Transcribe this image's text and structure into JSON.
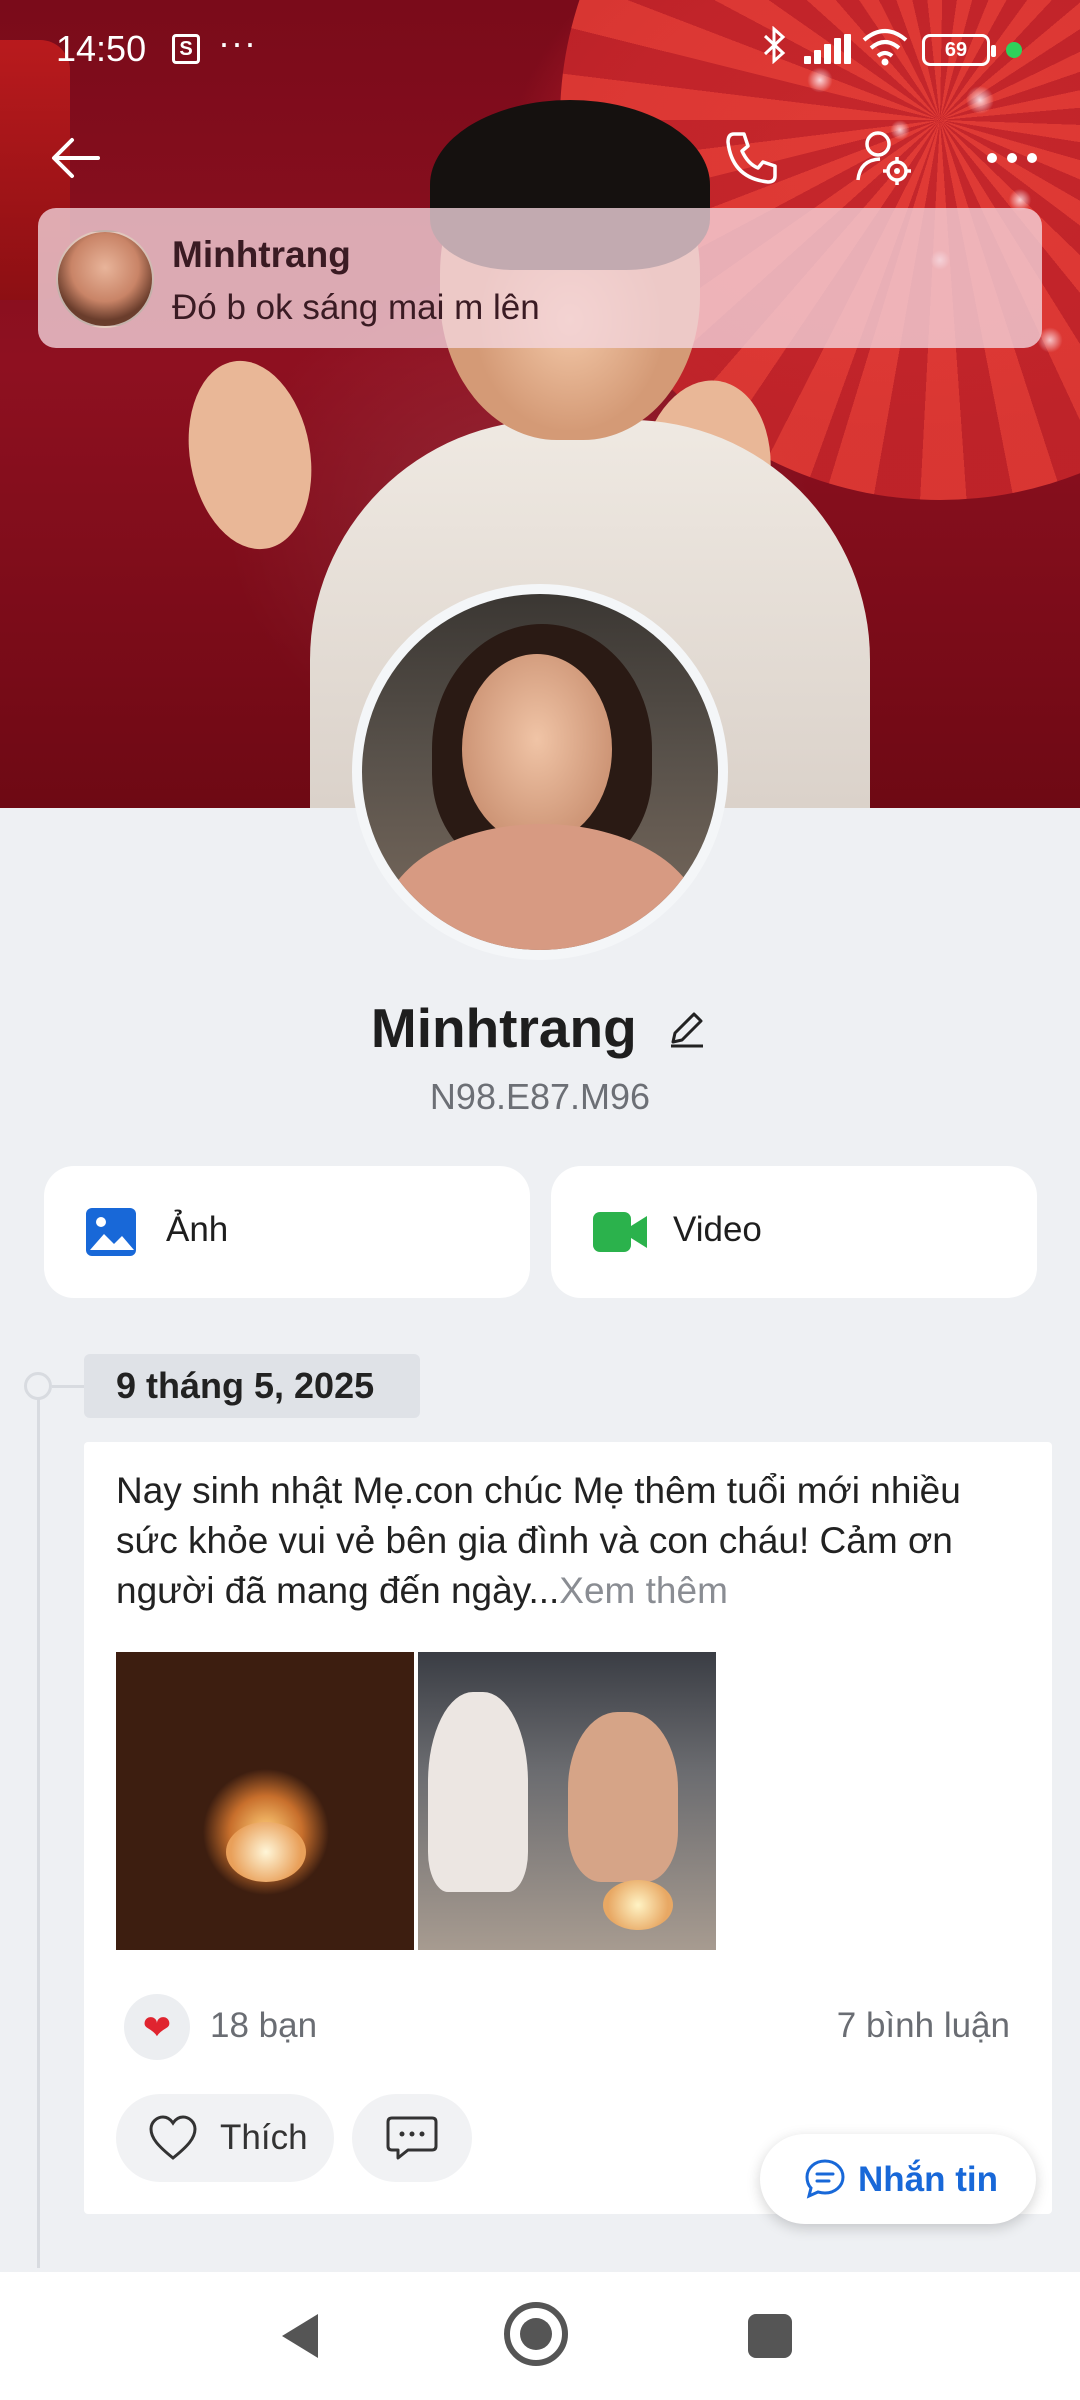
{
  "status_bar": {
    "time": "14:50",
    "shop_icon_letter": "S",
    "more_indicator": "···",
    "battery": "69",
    "icons": [
      "shopee-bag-icon",
      "bluetooth-icon",
      "signal-icon",
      "wifi-icon",
      "battery-icon",
      "active-dot-icon"
    ]
  },
  "top_bar": {
    "icons": [
      "back-arrow-icon",
      "phone-call-icon",
      "user-settings-icon",
      "more-dots-icon"
    ]
  },
  "notification": {
    "sender": "Minhtrang",
    "message": "Đó b ok sáng mai m lên"
  },
  "profile": {
    "name": "Minhtrang",
    "handle": "N98.E87.M96"
  },
  "media_cards": {
    "photo_label": "Ảnh",
    "video_label": "Video"
  },
  "timeline": {
    "date": "9 tháng 5, 2025"
  },
  "post": {
    "text": "Nay sinh nhật Mẹ.con chúc Mẹ thêm tuổi mới nhiều sức khỏe vui vẻ bên gia đình và con cháu! Cảm ơn người đã mang đến ngày...",
    "see_more": "Xem thêm",
    "reactions": "18 bạn",
    "comments": "7 bình luận",
    "like_label": "Thích",
    "heart_emoji": "❤"
  },
  "message_button": {
    "label": "Nhắn tin"
  },
  "colors": {
    "accent_blue": "#1868d8",
    "video_green": "#2bb24c",
    "heart_red": "#e0242f",
    "page_bg": "#eef0f3"
  }
}
